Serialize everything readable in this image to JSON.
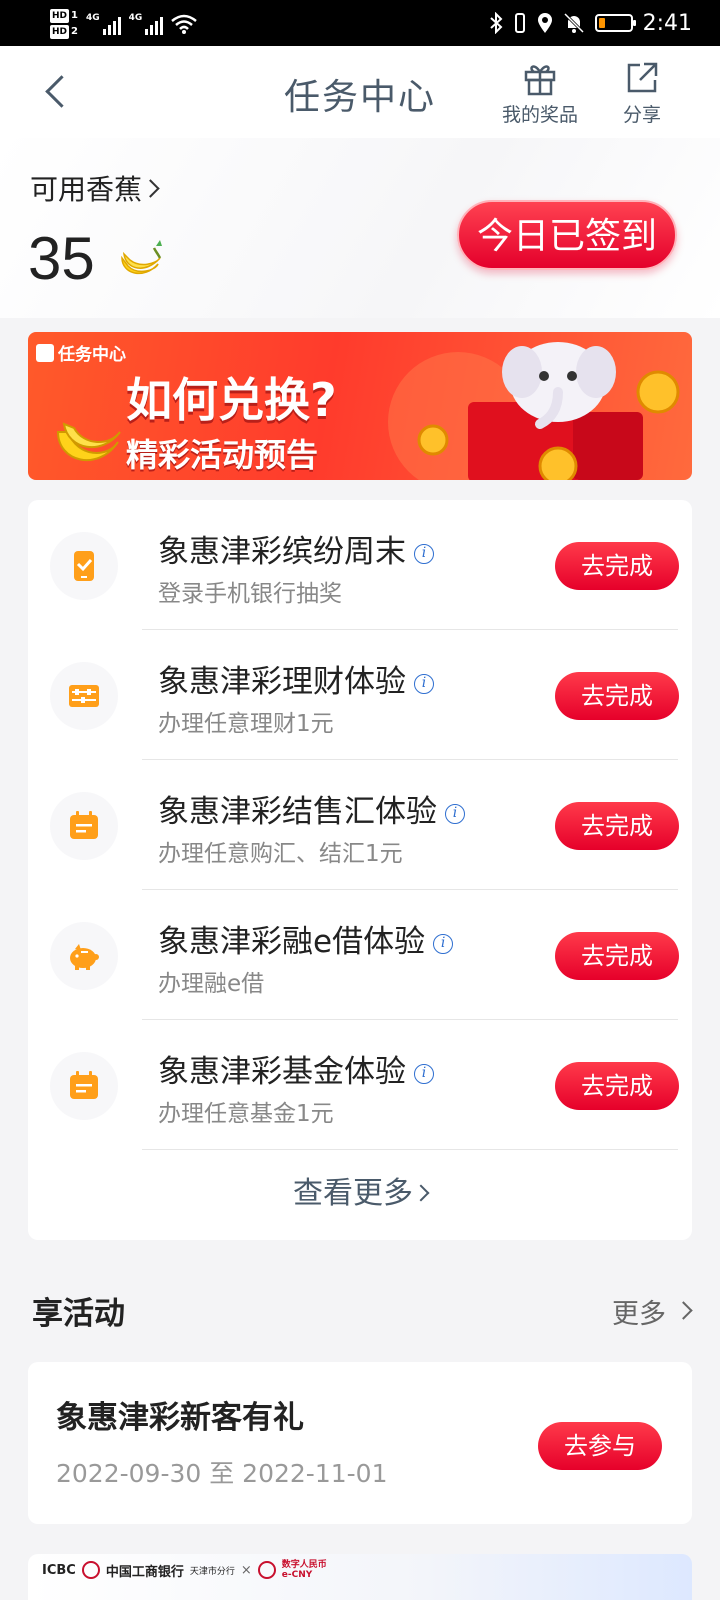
{
  "statusbar": {
    "hd1": "HD",
    "hd1_n": "1",
    "hd2": "HD",
    "hd2_n": "2",
    "net1": "4G",
    "net2": "4G",
    "time": "2:41"
  },
  "header": {
    "title": "任务中心",
    "prizes_label": "我的奖品",
    "share_label": "分享"
  },
  "points": {
    "label": "可用香蕉",
    "value": "35",
    "signin_label": "今日已签到"
  },
  "banner": {
    "tag": "任务中心",
    "headline": "如何兑换?",
    "subline": "精彩活动预告"
  },
  "tasks": [
    {
      "name": "象惠津彩缤纷周末",
      "desc": "登录手机银行抽奖",
      "button": "去完成",
      "icon": "phone-check-icon"
    },
    {
      "name": "象惠津彩理财体验",
      "desc": "办理任意理财1元",
      "button": "去完成",
      "icon": "abacus-icon"
    },
    {
      "name": "象惠津彩结售汇体验",
      "desc": "办理任意购汇、结汇1元",
      "button": "去完成",
      "icon": "calendar-icon"
    },
    {
      "name": "象惠津彩融e借体验",
      "desc": "办理融e借",
      "button": "去完成",
      "icon": "piggy-bank-icon"
    },
    {
      "name": "象惠津彩基金体验",
      "desc": "办理任意基金1元",
      "button": "去完成",
      "icon": "calendar-icon"
    }
  ],
  "tasks_more": "查看更多",
  "activities": {
    "title": "享活动",
    "more": "更多",
    "items": [
      {
        "name": "象惠津彩新客有礼",
        "date": "2022-09-30 至 2022-11-01",
        "button": "去参与"
      }
    ]
  },
  "bottom_banner": {
    "brand": "ICBC",
    "bank": "中国工商银行",
    "branch": "天津市分行",
    "times": "×",
    "ecny": "数字人民币",
    "ecny_en": "e-CNY"
  },
  "colors": {
    "accent_red": "#e6002a",
    "icon_orange": "#ff9f1a",
    "text_gray": "#4a5a6a"
  }
}
